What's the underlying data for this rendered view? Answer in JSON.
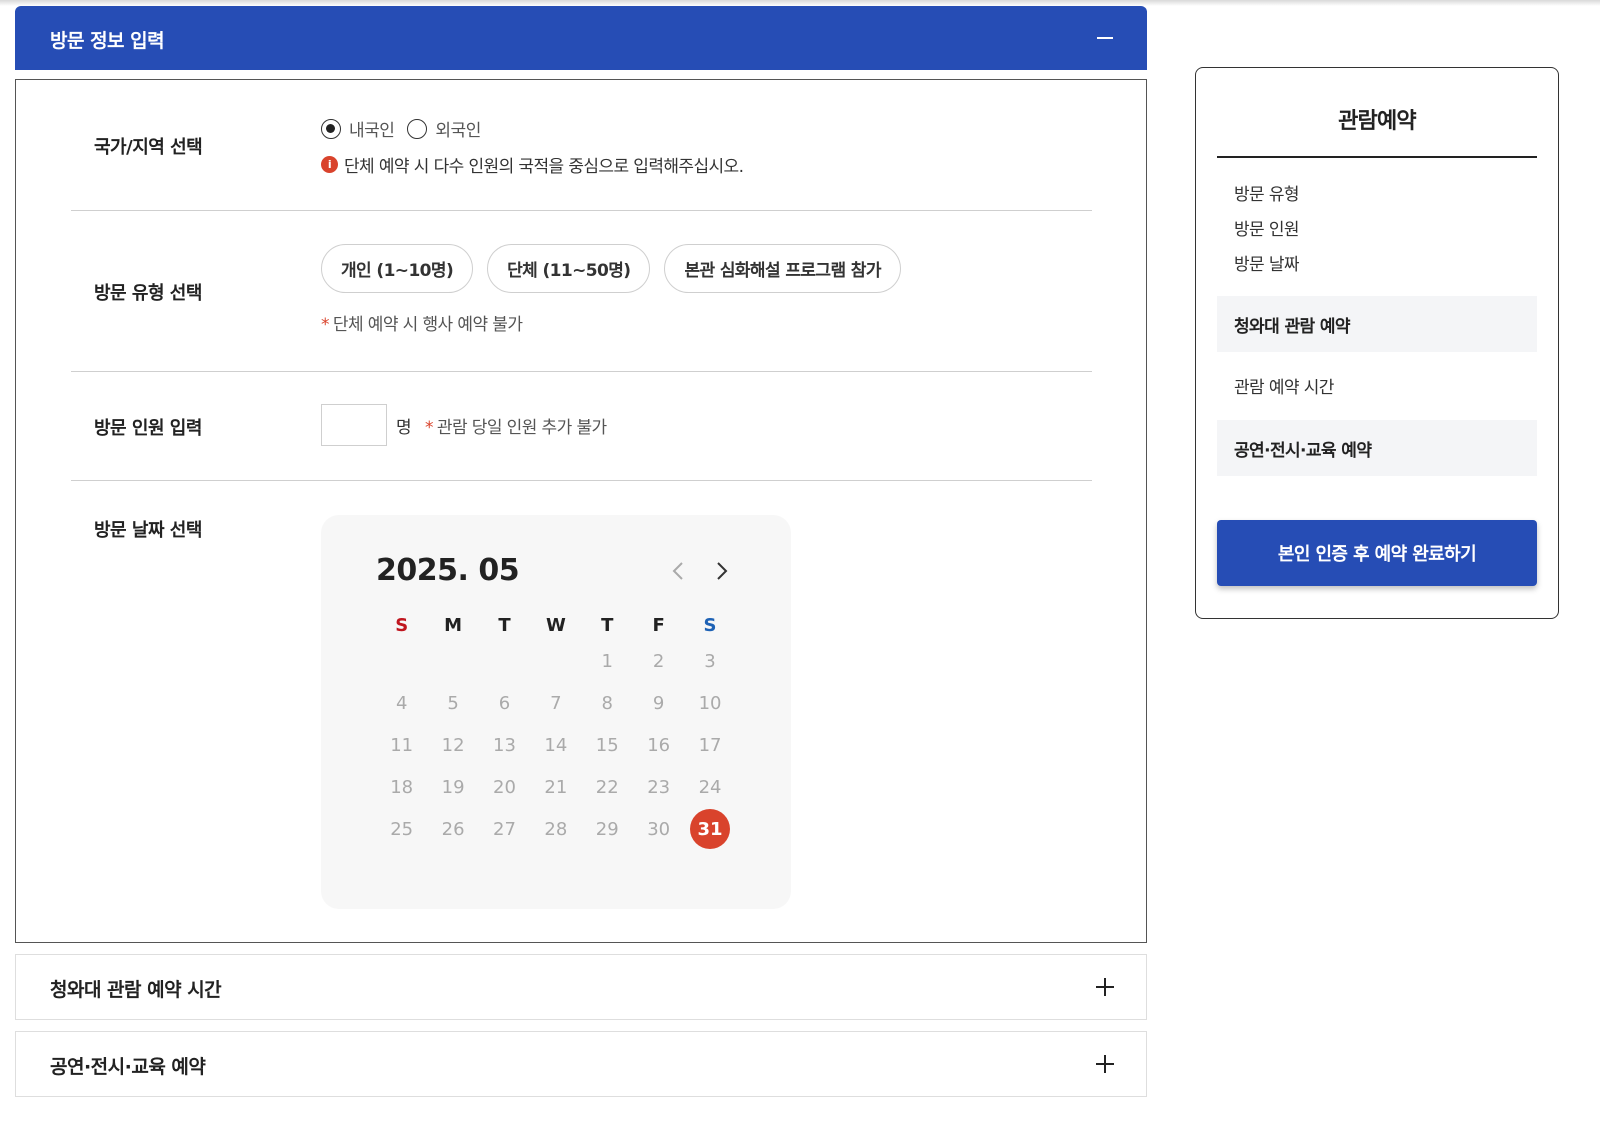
{
  "main_panel": {
    "title": "방문 정보 입력",
    "nationality": {
      "label": "국가/지역 선택",
      "options": [
        "내국인",
        "외국인"
      ],
      "selected": "내국인",
      "note": "단체 예약 시 다수 인원의 국적을 중심으로 입력해주십시오."
    },
    "visit_type": {
      "label": "방문 유형 선택",
      "options": [
        "개인 (1~10명)",
        "단체 (11~50명)",
        "본관 심화해설 프로그램 참가"
      ],
      "note": "단체 예약 시 행사 예약 불가"
    },
    "visitor_count": {
      "label": "방문 인원 입력",
      "value": "",
      "unit": "명",
      "note": "관람 당일 인원 추가 불가"
    },
    "visit_date": {
      "label": "방문 날짜 선택",
      "calendar": {
        "month_label": "2025. 05",
        "weekdays": [
          "S",
          "M",
          "T",
          "W",
          "T",
          "F",
          "S"
        ],
        "weeks": [
          [
            "",
            "",
            "",
            "",
            "1",
            "2",
            "3"
          ],
          [
            "4",
            "5",
            "6",
            "7",
            "8",
            "9",
            "10"
          ],
          [
            "11",
            "12",
            "13",
            "14",
            "15",
            "16",
            "17"
          ],
          [
            "18",
            "19",
            "20",
            "21",
            "22",
            "23",
            "24"
          ],
          [
            "25",
            "26",
            "27",
            "28",
            "29",
            "30",
            "31"
          ]
        ],
        "selected_day": "31",
        "selected_color": "#d9432c"
      }
    }
  },
  "accordions": [
    {
      "title": "청와대 관람 예약 시간"
    },
    {
      "title": "공연·전시·교육 예약"
    }
  ],
  "sidebar": {
    "title": "관람예약",
    "items": [
      "방문 유형",
      "방문 인원",
      "방문 날짜"
    ],
    "section1": "청와대 관람 예약",
    "section1_item": "관람 예약 시간",
    "section2": "공연·전시·교육 예약",
    "button": "본인 인증 후 예약 완료하기"
  },
  "colors": {
    "primary": "#264db5",
    "accent": "#d9432c",
    "sunday": "#c0161f",
    "saturday": "#1e62b5"
  }
}
